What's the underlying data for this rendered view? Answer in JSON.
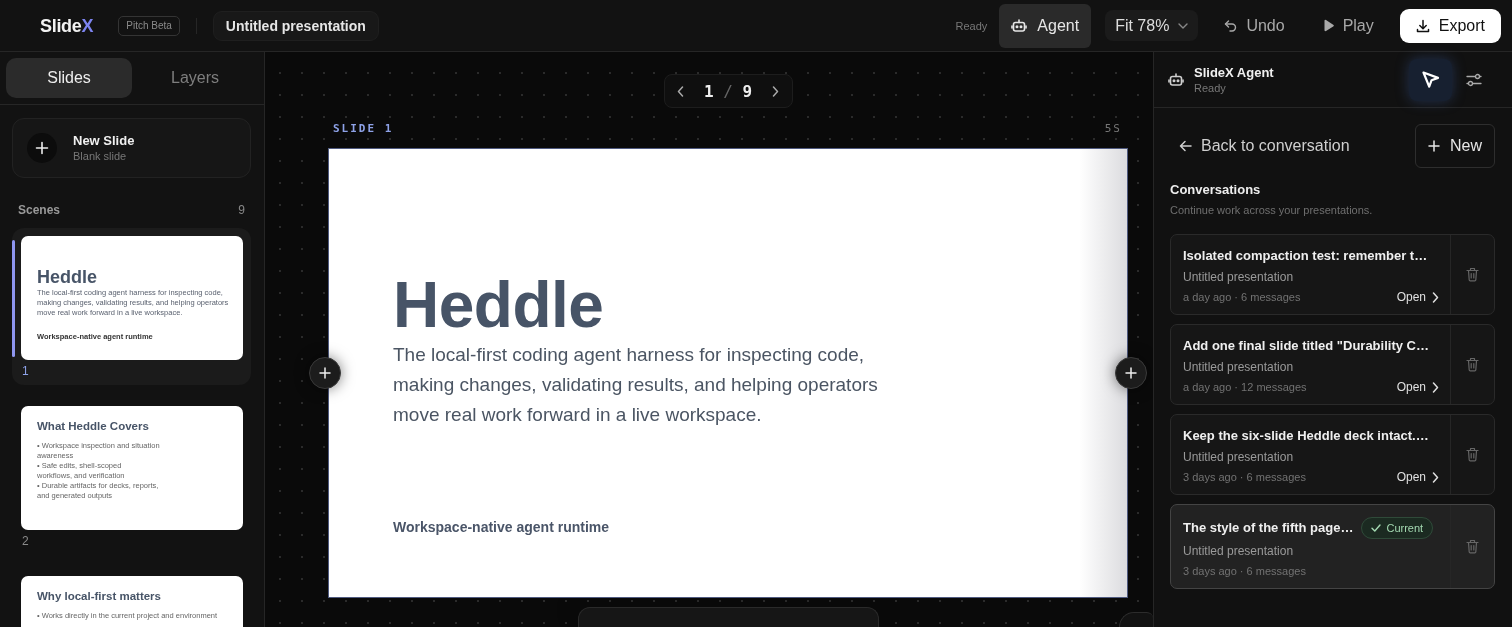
{
  "topbar": {
    "logo": {
      "text": "Slide",
      "accent": "X"
    },
    "badge": "Pitch Beta",
    "document_title": "Untitled presentation",
    "status": "Ready",
    "agent_button": {
      "label": "Agent",
      "on": true
    },
    "zoom_select": {
      "label": "Fit 78%"
    },
    "actions": [
      {
        "kind": "undo",
        "label": "Undo"
      },
      {
        "kind": "play",
        "label": "Play"
      },
      {
        "kind": "export",
        "label": "Export"
      }
    ]
  },
  "sidebar": {
    "tabs": [
      {
        "label": "Slides",
        "selected": true
      },
      {
        "label": "Layers",
        "selected": false
      }
    ],
    "new_slide": {
      "title": "New Slide",
      "subtitle": "Blank slide"
    },
    "scenes": {
      "label": "Scenes",
      "count": "9"
    },
    "slides": [
      {
        "kind": "title",
        "number": "1",
        "selected": true,
        "title": "Heddle",
        "lines": [
          "The local-first coding agent harness for inspecting code,",
          "making changes, validating results, and helping operators",
          "move real work forward in a live workspace."
        ],
        "footer": "Workspace-native agent runtime"
      },
      {
        "kind": "bullets",
        "number": "2",
        "selected": false,
        "title": "What Heddle Covers",
        "bullets": [
          {
            "lines": [
              "• Workspace inspection and situation",
              "awareness"
            ]
          },
          {
            "lines": [
              "• Safe edits, shell-scoped",
              "workflows, and verification"
            ]
          },
          {
            "lines": [
              "• Durable artifacts for decks, reports,",
              "and generated outputs"
            ]
          }
        ]
      },
      {
        "kind": "bullets",
        "selected": false,
        "title": "Why local-first matters",
        "bullets": [
          {
            "lines": [
              "• Works directly in the current project and environment"
            ]
          }
        ]
      }
    ]
  },
  "canvas": {
    "pager": {
      "current": "1",
      "separator": "/",
      "total": "9"
    },
    "slide_label": "SLIDE 1",
    "duration": "5S",
    "slide": {
      "title": "Heddle",
      "lines": [
        "The local-first coding agent harness for inspecting code,",
        "making changes, validating results, and helping operators",
        "move real work forward in a live workspace."
      ],
      "footer": "Workspace-native agent runtime"
    }
  },
  "agent_panel": {
    "title": "SlideX Agent",
    "status": "Ready",
    "pointer_tool": {
      "on": true
    },
    "back_label": "Back to conversation",
    "new_label": "New",
    "section_title": "Conversations",
    "section_subtitle": "Continue work across your presentations.",
    "conversations": [
      {
        "title": "Isolated compaction test: remember t…",
        "document": "Untitled presentation",
        "meta": "a day ago · 6 messages",
        "action": "Open",
        "selected": false
      },
      {
        "title": "Add one final slide titled \"Durability C…",
        "document": "Untitled presentation",
        "meta": "a day ago · 12 messages",
        "action": "Open",
        "selected": false
      },
      {
        "title": "Keep the six-slide Heddle deck intact.…",
        "document": "Untitled presentation",
        "meta": "3 days ago · 6 messages",
        "action": "Open",
        "selected": false
      },
      {
        "title": "The style of the fifth page…",
        "badge": "Current",
        "document": "Untitled presentation",
        "meta": "3 days ago · 6 messages",
        "selected": true
      }
    ]
  }
}
